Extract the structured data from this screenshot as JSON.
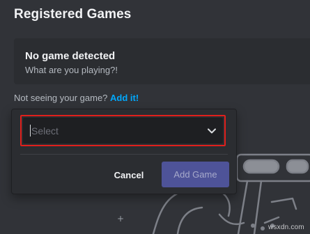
{
  "header": {
    "title": "Registered Games"
  },
  "detection": {
    "status": "No game detected",
    "subtitle": "What are you playing?!"
  },
  "prompt": {
    "question": "Not seeing your game?",
    "link_label": "Add it!"
  },
  "add_game_dialog": {
    "select": {
      "placeholder": "Select",
      "icon": "chevron-down-icon"
    },
    "cancel_label": "Cancel",
    "add_label": "Add Game"
  },
  "watermark": "wsxdn.com",
  "colors": {
    "background": "#313338",
    "card": "#2b2d31",
    "link": "#00a8fc",
    "highlight_border": "#e0201c",
    "button_disabled": "#4e5398"
  }
}
